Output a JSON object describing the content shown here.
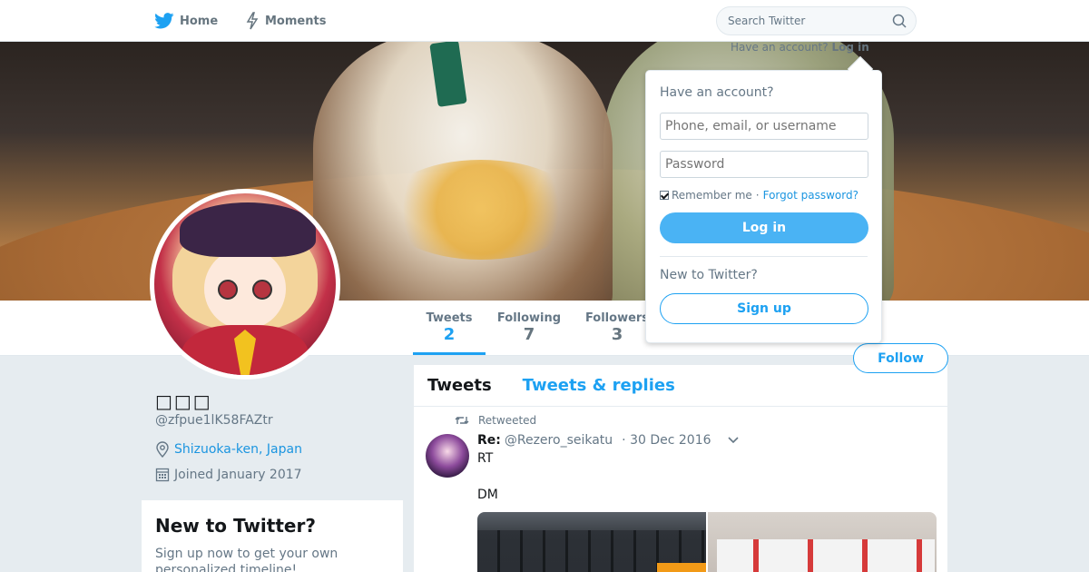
{
  "nav": {
    "home_label": "Home",
    "moments_label": "Moments",
    "search_placeholder": "Search Twitter"
  },
  "login_hint": {
    "question": "Have an account?",
    "link": "Log in"
  },
  "profile": {
    "name": "□□□",
    "handle": "@zfpue1lK58FAZtr",
    "location": "Shizuoka-ken, Japan",
    "joined": "Joined January 2017"
  },
  "stats": [
    {
      "label": "Tweets",
      "value": "2"
    },
    {
      "label": "Following",
      "value": "7"
    },
    {
      "label": "Followers",
      "value": "3"
    }
  ],
  "follow_label": "Follow",
  "signup_card": {
    "title": "New to Twitter?",
    "text": "Sign up now to get your own personalized timeline!"
  },
  "timeline": {
    "tabs": [
      "Tweets",
      "Tweets & replies"
    ],
    "tweet": {
      "retweeted_label": "Retweeted",
      "author": "Re:",
      "handle": "@Rezero_seikatu",
      "time": "· 30 Dec 2016",
      "line1": "RT",
      "line2": "DM"
    }
  },
  "login_dropdown": {
    "heading": "Have an account?",
    "username_placeholder": "Phone, email, or username",
    "password_placeholder": "Password",
    "remember_label": "Remember me",
    "separator": "·",
    "forgot_label": "Forgot password?",
    "login_button": "Log in",
    "new_heading": "New to Twitter?",
    "signup_button": "Sign up"
  },
  "colors": {
    "accent": "#1da1f2",
    "login_button": "#4ab3f4",
    "background": "#e6ecf0"
  }
}
